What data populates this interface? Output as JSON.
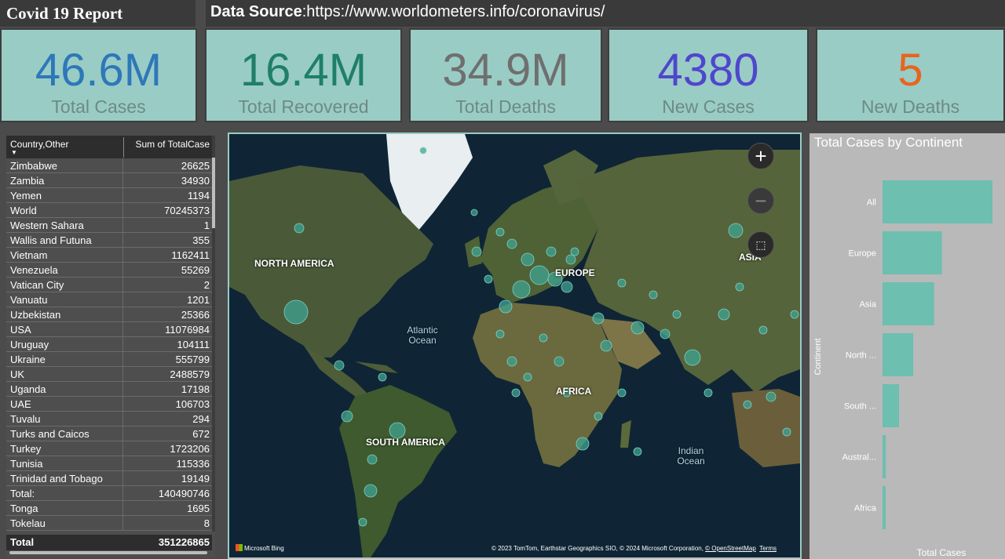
{
  "header": {
    "title": "Covid 19 Report",
    "source_label": "Data Source",
    "source_url": ":https://www.worldometers.info/coronavirus/"
  },
  "kpis": [
    {
      "value": "46.6M",
      "label": "Total Cases",
      "color": "#2e77b8"
    },
    {
      "value": "16.4M",
      "label": "Total Recovered",
      "color": "#1f7f68"
    },
    {
      "value": "34.9M",
      "label": "Total Deaths",
      "color": "#6f6f6f"
    },
    {
      "value": "4380",
      "label": "New Cases",
      "color": "#5046cc"
    },
    {
      "value": "5",
      "label": "New Deaths",
      "color": "#e8641e"
    }
  ],
  "table": {
    "col1": "Country,Other",
    "col2": "Sum of TotalCase",
    "rows": [
      {
        "name": "Zimbabwe",
        "value": "26625"
      },
      {
        "name": "Zambia",
        "value": "34930"
      },
      {
        "name": "Yemen",
        "value": "1194"
      },
      {
        "name": "World",
        "value": "70245373"
      },
      {
        "name": "Western Sahara",
        "value": "1"
      },
      {
        "name": "Wallis and Futuna",
        "value": "355"
      },
      {
        "name": "Vietnam",
        "value": "1162411"
      },
      {
        "name": "Venezuela",
        "value": "55269"
      },
      {
        "name": "Vatican City",
        "value": "2"
      },
      {
        "name": "Vanuatu",
        "value": "1201"
      },
      {
        "name": "Uzbekistan",
        "value": "25366"
      },
      {
        "name": "USA",
        "value": "11076984"
      },
      {
        "name": "Uruguay",
        "value": "104111"
      },
      {
        "name": "Ukraine",
        "value": "555799"
      },
      {
        "name": "UK",
        "value": "2488579"
      },
      {
        "name": "Uganda",
        "value": "17198"
      },
      {
        "name": "UAE",
        "value": "106703"
      },
      {
        "name": "Tuvalu",
        "value": "294"
      },
      {
        "name": "Turks and Caicos",
        "value": "672"
      },
      {
        "name": "Turkey",
        "value": "1723206"
      },
      {
        "name": "Tunisia",
        "value": "115336"
      },
      {
        "name": "Trinidad and Tobago",
        "value": "19149"
      },
      {
        "name": "Total:",
        "value": "140490746"
      },
      {
        "name": "Tonga",
        "value": "1695"
      },
      {
        "name": "Tokelau",
        "value": "8"
      }
    ],
    "total_label": "Total",
    "total_value": "351226865"
  },
  "map": {
    "labels": [
      "NORTH AMERICA",
      "EUROPE",
      "ASIA",
      "AFRICA",
      "SOUTH AMERICA"
    ],
    "oceans": [
      "Atlantic Ocean",
      "Indian Ocean"
    ],
    "zoom_in": "+",
    "zoom_out": "−",
    "bing": "Microsoft Bing",
    "copyright": "© 2023 TomTom, Earthstar Geographics SIO, © 2024 Microsoft Corporation,",
    "osm": "© OpenStreetMap",
    "terms": "Terms"
  },
  "chart_data": {
    "type": "bar",
    "orientation": "horizontal",
    "title": "Total Cases by Continent",
    "ylabel": "Continent",
    "xlabel": "Total Cases",
    "categories": [
      "All",
      "Europe",
      "Asia",
      "North ...",
      "South ...",
      "Austral...",
      "Africa"
    ],
    "values": [
      100,
      54,
      47,
      28,
      15,
      3,
      2
    ],
    "bar_color": "#6dbfb0"
  }
}
